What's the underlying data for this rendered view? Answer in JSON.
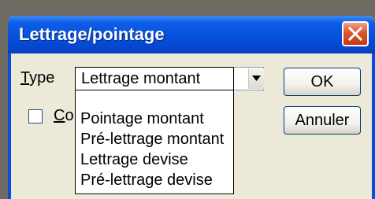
{
  "dialog": {
    "title": "Lettrage/pointage",
    "close_icon": "close-icon"
  },
  "form": {
    "type_label_underlined": "T",
    "type_label_rest": "ype",
    "type_selected": "Lettrage montant",
    "checkbox_label_underlined": "C",
    "checkbox_label_rest": "o",
    "checkbox_checked": false
  },
  "buttons": {
    "ok": "OK",
    "cancel": "Annuler"
  },
  "dropdown_options": [
    "Pointage montant",
    "Pré-lettrage montant",
    "Lettrage devise",
    "Pré-lettrage devise"
  ],
  "colors": {
    "titlebar": "#0550db",
    "close_button": "#d9542e",
    "dialog_bg": "#ece9d8"
  }
}
